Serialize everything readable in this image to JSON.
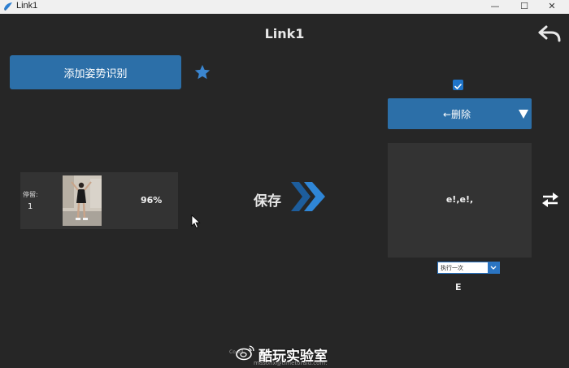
{
  "window": {
    "title": "Link1",
    "minimize_glyph": "—",
    "maximize_glyph": "☐",
    "close_glyph": "✕"
  },
  "header": {
    "title": "Link1",
    "back_icon": "back-arrow-icon"
  },
  "left": {
    "add_pose_label": "添加姿势识别",
    "star_icon": "star-icon",
    "pose_card": {
      "hold_label": "停留:",
      "hold_value": "1",
      "confidence": "96%"
    }
  },
  "center": {
    "save_label": "保存",
    "arrow_icon": "double-chevron-right-icon"
  },
  "right": {
    "checkbox_checked": true,
    "delete_label": "←删除",
    "action_text": "e!,e!,",
    "run_mode_selected": "执行一次",
    "key_label": "E",
    "swap_icon": "swap-arrows-icon"
  },
  "watermark": {
    "copyright": "Co                                       ed.",
    "email": "masonx@timetoraid.com.",
    "brand": "酷玩实验室"
  },
  "colors": {
    "background": "#262626",
    "accent": "#2c6fa8",
    "card": "#333333",
    "chevron": "#2f86d6"
  }
}
